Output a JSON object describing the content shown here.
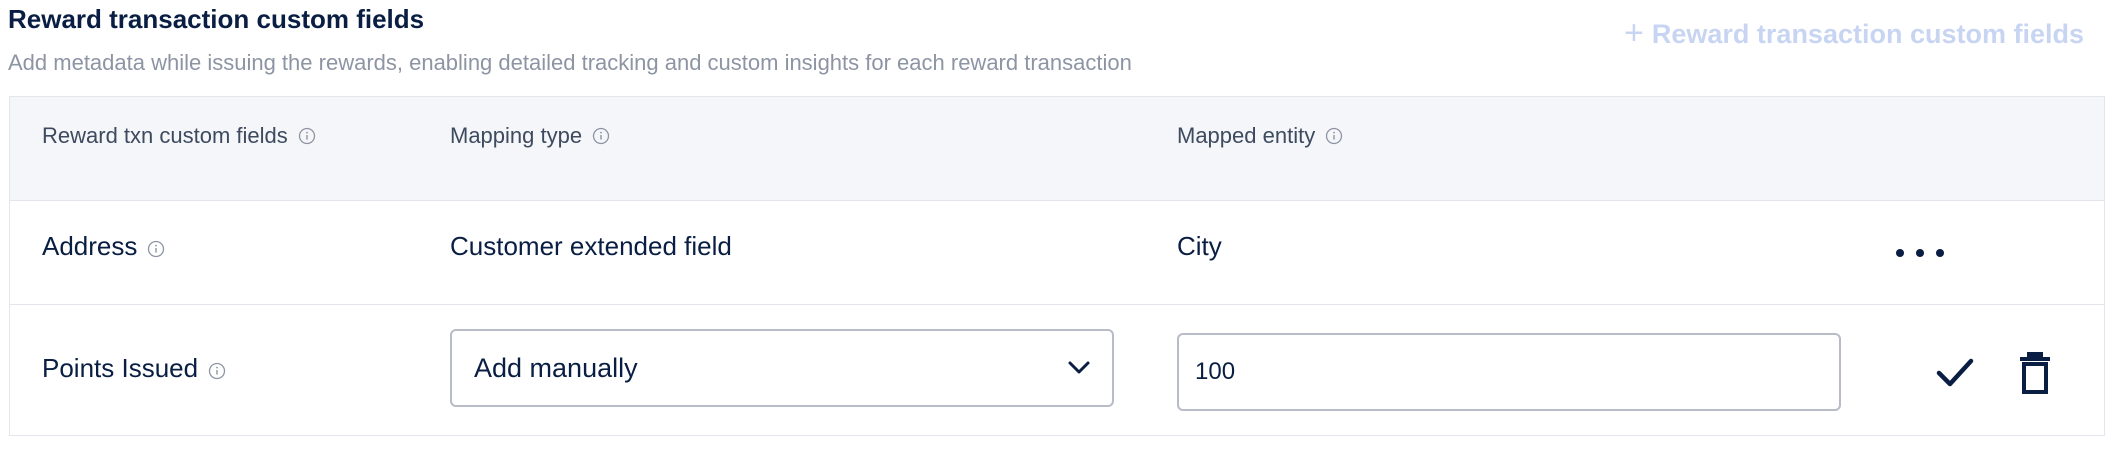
{
  "section": {
    "title": "Reward transaction custom fields",
    "description": "Add metadata while issuing the rewards, enabling detailed tracking and custom insights for each reward transaction",
    "add_button_label": "Reward transaction custom fields"
  },
  "table": {
    "headers": [
      {
        "label": "Reward txn custom fields"
      },
      {
        "label": "Mapping type"
      },
      {
        "label": "Mapped entity"
      }
    ],
    "rows": [
      {
        "field": "Address",
        "mapping_type": "Customer extended field",
        "mapped_entity": "City"
      },
      {
        "field": "Points Issued",
        "mapping_type": "Add manually",
        "mapped_entity": "100"
      }
    ]
  },
  "colors": {
    "text_primary": "#091e42",
    "text_secondary": "#8d94a3",
    "link_disabled": "#c8d5f2",
    "header_bg": "#f4f6f9",
    "border": "#e3e6ec"
  },
  "icons": {
    "info": "info-icon",
    "more": "more-horizontal-icon",
    "dropdown": "chevron-down-icon",
    "confirm": "checkmark-icon",
    "delete": "trash-icon",
    "add": "plus-icon"
  }
}
